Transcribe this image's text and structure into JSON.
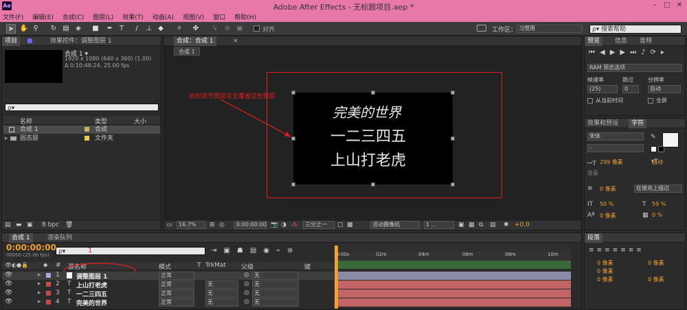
{
  "window": {
    "app_icon": "Ae",
    "title": "Adobe After Effects - 无标题项目.aep *",
    "min": "–",
    "max": "□",
    "close": "✕"
  },
  "menu": [
    "文件(F)",
    "编辑(E)",
    "合成(C)",
    "图层(L)",
    "效果(T)",
    "动画(A)",
    "视图(V)",
    "窗口",
    "帮助(H)"
  ],
  "toolbar": {
    "snap_label": "对齐",
    "workspace_label": "工作区：",
    "workspace_value": "习惯用",
    "help_search": "搜索帮助"
  },
  "project": {
    "tab_project": "项目",
    "tab_effects": "效果控件：调整图层 1",
    "comp_name": "合成 1 ▾",
    "comp_info1": "1920 x 1080 (640 x 360) (1.00)",
    "comp_info2": "Δ 0:10:48:24, 25.00 fps",
    "search_placeholder": "ρ▾",
    "col_name": "名称",
    "col_type": "类型",
    "col_size": "大小",
    "items": [
      {
        "name": "合成 1",
        "type": "合成",
        "color": "#c8b060"
      },
      {
        "name": "固态层",
        "type": "文件夹",
        "color": "#e8d040"
      }
    ],
    "bpc": "8 bpc"
  },
  "composition": {
    "tab": "合成：合成 1",
    "sub_tab": "合成 1",
    "lines": [
      "完美的世界",
      "一二三四五",
      "上山打老虎"
    ],
    "annotation": "此时调节图层完全覆盖这些图层",
    "zoom": "16.7%",
    "timecode": "0:00:00:00",
    "resolution": "三分之一",
    "camera": "活动摄像机",
    "views": "1 ...",
    "exposure": "+0.0"
  },
  "preview": {
    "tab_preview": "预览",
    "tab_info": "信息",
    "tab_audio": "音频",
    "ram_options": "RAM 预览选项",
    "frame_rate_label": "帧速率",
    "skip_label": "跳过",
    "resolution_label": "分辨率",
    "frame_rate": "(25)",
    "skip": "0",
    "resolution": "自动",
    "from_current": "从当前时间",
    "fullscreen": "全屏"
  },
  "character": {
    "tab_effects": "效果和预设",
    "tab_char": "字符",
    "font": "宋体",
    "style": "-",
    "size": "299 像素",
    "leading": "自动",
    "tracking_unit": "像素",
    "kerning": "0",
    "stroke_width": "0 像素",
    "stroke_mode": "在填充上描边",
    "vscale": "50 %",
    "hscale": "59 %",
    "baseline": "0 像素",
    "tsume": "0 %"
  },
  "timeline": {
    "tab_comp": "合成 1",
    "tab_render": "渲染队列",
    "timecode": "0:00:00:00",
    "frames": "00000 (25.00 fps)",
    "search_placeholder": "ρ▾",
    "annot_1": "1",
    "col_num": "#",
    "col_name": "源名称",
    "col_mode": "模式",
    "col_t": "T",
    "col_trkmat": "TrkMat",
    "col_parent": "父级",
    "col_key": "键",
    "ruler": [
      "0:00s",
      "02m",
      "04m",
      "06m",
      "08m",
      "10m"
    ],
    "layers": [
      {
        "num": "1",
        "name": "调整图层 1",
        "mode": "正常",
        "trkmat": "",
        "parent": "无",
        "color": "#a9a9d8"
      },
      {
        "num": "2",
        "name": "上山打老虎",
        "mode": "正常",
        "trkmat": "无",
        "parent": "无",
        "color": "#c84a4a"
      },
      {
        "num": "3",
        "name": "一二三四五",
        "mode": "正常",
        "trkmat": "无",
        "parent": "无",
        "color": "#c84a4a"
      },
      {
        "num": "4",
        "name": "完美的世界",
        "mode": "正常",
        "trkmat": "无",
        "parent": "无",
        "color": "#c84a4a"
      }
    ]
  },
  "paragraph": {
    "tab": "段落",
    "values": [
      "0 像素",
      "0 像素",
      "0 像素",
      "0 像素",
      "0 像素"
    ]
  },
  "accent": {
    "pink": "#e878a8",
    "orange": "#f0a030",
    "red": "#e02020"
  }
}
